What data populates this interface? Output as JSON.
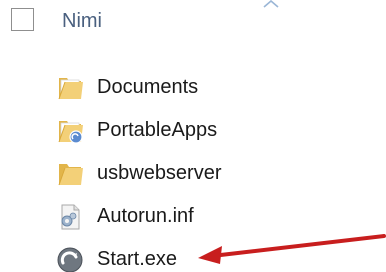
{
  "header": {
    "column_label": "Nimi"
  },
  "files": [
    {
      "name": "Documents",
      "icon": "folder-icon"
    },
    {
      "name": "PortableApps",
      "icon": "folder-shortcut-icon"
    },
    {
      "name": "usbwebserver",
      "icon": "folder-icon"
    },
    {
      "name": "Autorun.inf",
      "icon": "settings-file-icon"
    },
    {
      "name": "Start.exe",
      "icon": "app-exe-icon"
    }
  ],
  "colors": {
    "header_text": "#4a607f",
    "folder": "#f0c85a",
    "arrow": "#c81e1e"
  }
}
